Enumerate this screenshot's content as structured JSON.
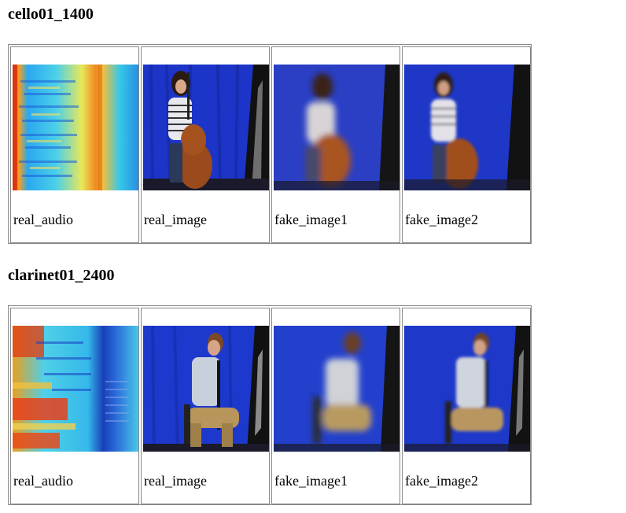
{
  "sections": [
    {
      "title": "cello01_1400",
      "cells": [
        {
          "caption": "real_audio",
          "image": "spectrogram-image"
        },
        {
          "caption": "real_image",
          "image": "cellist-image"
        },
        {
          "caption": "fake_image1",
          "image": "cellist-blurred-image"
        },
        {
          "caption": "fake_image2",
          "image": "cellist-generated-image"
        }
      ]
    },
    {
      "title": "clarinet01_2400",
      "cells": [
        {
          "caption": "real_audio",
          "image": "spectrogram-image"
        },
        {
          "caption": "real_image",
          "image": "clarinetist-image"
        },
        {
          "caption": "fake_image1",
          "image": "clarinetist-blurred-image"
        },
        {
          "caption": "fake_image2",
          "image": "clarinetist-generated-image"
        }
      ]
    }
  ]
}
